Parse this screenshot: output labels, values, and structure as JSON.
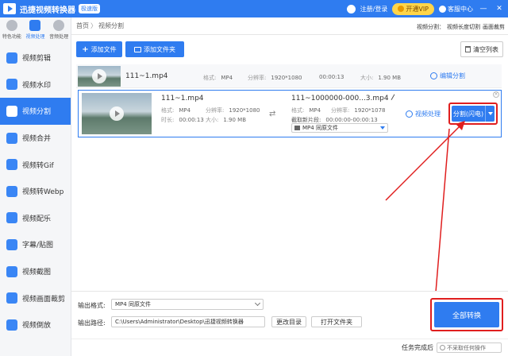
{
  "app": {
    "title": "迅捷视频转换器",
    "edition": "极速版",
    "login": "注册/登录",
    "vip": "开通VIP",
    "service": "客服中心",
    "min": "—",
    "close": "✕"
  },
  "modes": [
    {
      "label": "特色功能"
    },
    {
      "label": "视频处理"
    },
    {
      "label": "音频处理"
    }
  ],
  "nav": [
    "视频剪辑",
    "视频水印",
    "视频分割",
    "视频合并",
    "视频转Gif",
    "视频转Webp",
    "视频配乐",
    "字幕/贴图",
    "视频截图",
    "视频画面裁剪",
    "视频倒放"
  ],
  "breadcrumb": {
    "home": "首页",
    "sep": "〉",
    "current": "视频分割"
  },
  "crumb_links": {
    "a": "视频分割：",
    "b": "视频长度切割",
    "c": "画面裁剪"
  },
  "toolbar": {
    "add_file": "添加文件",
    "add_folder": "添加文件夹",
    "clear": "清空列表"
  },
  "row1": {
    "name": "111~1.mp4",
    "fmt_label": "格式:",
    "fmt": "MP4",
    "res_label": "分辨率:",
    "res": "1920*1080",
    "dur": "00:00:13",
    "size_label": "大小:",
    "size": "1.90 MB",
    "edit": "编辑分割"
  },
  "row2": {
    "name": "111~1.mp4",
    "fmt_label": "格式:",
    "fmt": "MP4",
    "res_label": "分辨率:",
    "res": "1920*1080",
    "dur_label": "时长:",
    "dur": "00:00:13",
    "size_label": "大小:",
    "size": "1.90 MB",
    "out_name": "111~1000000-000...3.mp4",
    "out_fmt_label": "格式:",
    "out_fmt": "MP4",
    "out_res_label": "分辨率:",
    "out_res": "1920*1078",
    "clip_label": "截取新片段:",
    "clip": "00:00:00-00:00:13",
    "format_select": "MP4  同原文件",
    "video_proc": "视频处理",
    "split": "分割(闪电)"
  },
  "bottom": {
    "format_label": "输出格式:",
    "format_value": "MP4  同原文件",
    "path_label": "输出路径:",
    "path_value": "C:\\Users\\Administrator\\Desktop\\迅捷视频转换器",
    "change_dir": "更改目录",
    "open_folder": "打开文件夹",
    "convert_all": "全部转换"
  },
  "status": {
    "after_label": "任务完成后",
    "after_value": "不采取任何操作"
  },
  "colors": {
    "primary": "#2f7cf0",
    "highlight": "#e01e1e"
  }
}
